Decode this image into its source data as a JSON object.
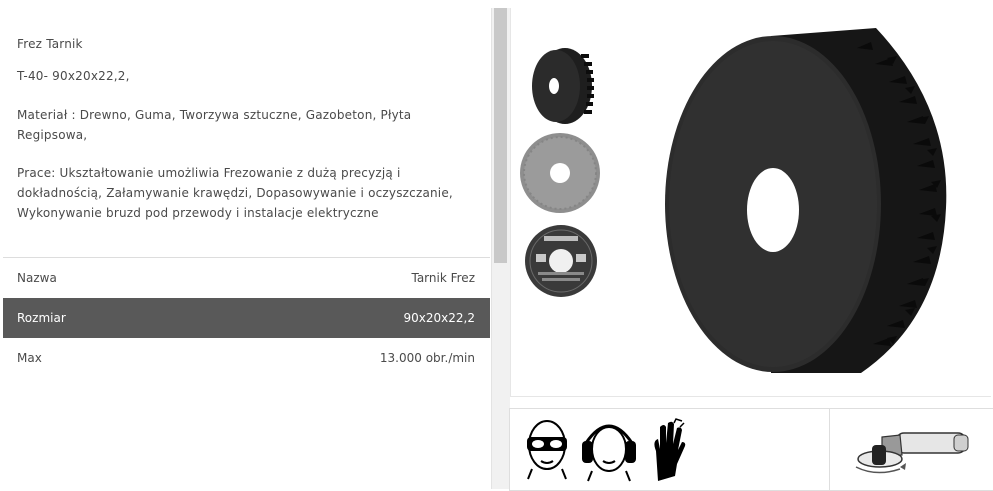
{
  "product": {
    "name": "Frez Tarnik",
    "model": "T-40- 90x20x22,2,",
    "material": "Materiał : Drewno, Guma, Tworzywa sztuczne, Gazobeton, Płyta Regipsowa,",
    "work": "Prace: Ukształtowanie umożliwia Frezowanie z dużą precyzją i dokładnością, Załamywanie krawędzi, Dopasowywanie i oczyszczanie, Wykonywanie bruzd pod przewody i instalacje elektryczne"
  },
  "specs": [
    {
      "label": "Nazwa",
      "value": "Tarnik Frez"
    },
    {
      "label": "Rozmiar",
      "value": "90x20x22,2"
    },
    {
      "label": "Max",
      "value": "13.000 obr./min"
    }
  ],
  "gallery": {
    "thumbnails": [
      "rasp-disc-side-view",
      "rasp-disc-front-view",
      "rasp-disc-packaging"
    ],
    "main_image": "rasp-disc-large"
  },
  "safety_icons": [
    "safety-goggles-icon",
    "ear-protection-icon",
    "protective-gloves-icon",
    "angle-grinder-icon"
  ],
  "colors": {
    "active_row": "#595959",
    "disc": "#2a2a2a"
  }
}
